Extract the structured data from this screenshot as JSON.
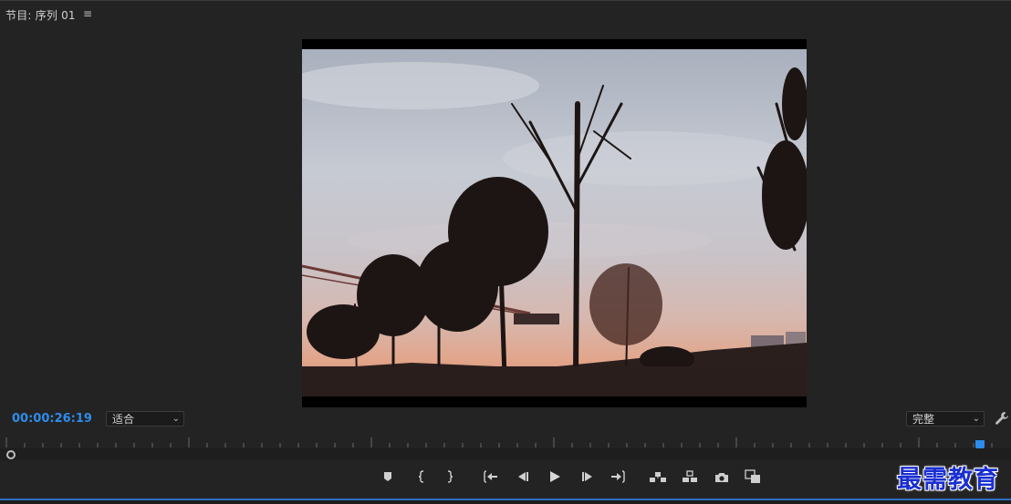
{
  "panel": {
    "title": "节目: 序列 01",
    "menu_icon": "hamburger-menu-icon"
  },
  "monitor": {
    "timecode": "00:00:26:19",
    "zoom_select": {
      "value": "适合"
    },
    "quality_select": {
      "value": "完整"
    },
    "settings_icon": "wrench-icon"
  },
  "transport": {
    "buttons": [
      {
        "name": "add-marker-button",
        "icon": "marker-icon"
      },
      {
        "name": "mark-in-button",
        "icon": "mark-in-icon"
      },
      {
        "name": "mark-out-button",
        "icon": "mark-out-icon"
      },
      {
        "name": "go-to-in-button",
        "icon": "go-to-in-icon"
      },
      {
        "name": "step-back-button",
        "icon": "step-back-icon"
      },
      {
        "name": "play-button",
        "icon": "play-icon"
      },
      {
        "name": "step-forward-button",
        "icon": "step-forward-icon"
      },
      {
        "name": "go-to-out-button",
        "icon": "go-to-out-icon"
      },
      {
        "name": "lift-button",
        "icon": "lift-icon"
      },
      {
        "name": "extract-button",
        "icon": "extract-icon"
      },
      {
        "name": "export-frame-button",
        "icon": "camera-icon"
      },
      {
        "name": "comparison-view-button",
        "icon": "comparison-icon"
      }
    ]
  },
  "watermark": "最需教育",
  "colors": {
    "background": "#232323",
    "timecode": "#2d8ceb",
    "playhead": "#2d8ceb",
    "watermark": "#1a2fd0"
  }
}
